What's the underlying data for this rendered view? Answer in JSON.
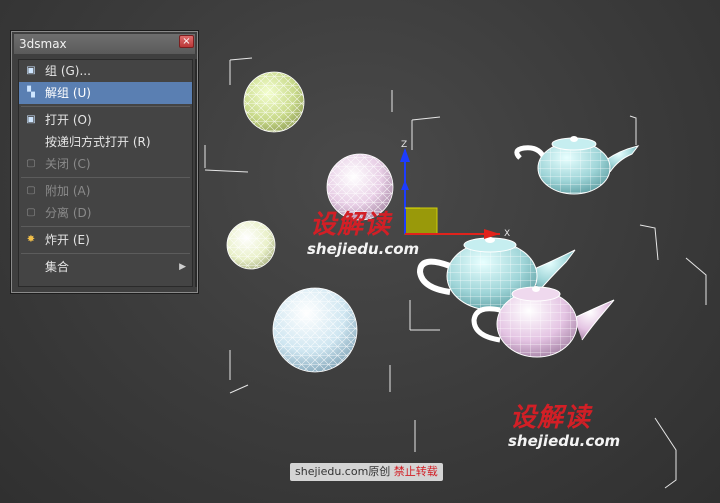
{
  "window": {
    "title": "3dsmax",
    "close_glyph": "×"
  },
  "menu": {
    "items": [
      {
        "label": "组 (G)...",
        "icon": "group-icon"
      },
      {
        "label": "解组 (U)",
        "icon": "ungroup-icon"
      },
      {
        "label": "打开 (O)",
        "icon": "open-group-icon"
      },
      {
        "label": "按递归方式打开 (R)",
        "icon": ""
      },
      {
        "label": "关闭 (C)",
        "icon": "close-group-icon"
      },
      {
        "label": "附加 (A)",
        "icon": "attach-icon"
      },
      {
        "label": "分离 (D)",
        "icon": "detach-icon"
      },
      {
        "label": "炸开 (E)",
        "icon": "explode-icon"
      },
      {
        "label": "集合",
        "icon": ""
      }
    ]
  },
  "watermark": {
    "logo_text": "设解读",
    "url_text": "shejiedu.com",
    "footer_site": "shejiedu.com",
    "footer_original": "原创",
    "footer_notice": "禁止转载"
  },
  "gizmo": {
    "y_axis_label": "Z",
    "x_axis_label": "X"
  },
  "colors": {
    "accent_selected": "#5a7fb2",
    "watermark_red": "#d21f26",
    "gizmo_blue": "#1c3cff",
    "gizmo_red": "#e0231c",
    "gizmo_yellow": "#e8e800"
  }
}
